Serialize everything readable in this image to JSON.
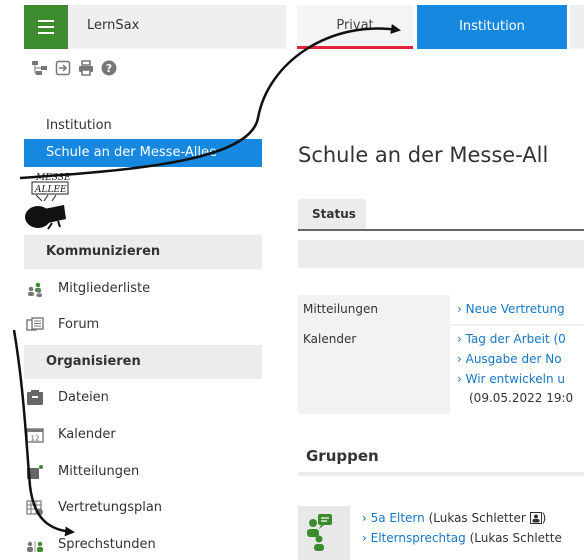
{
  "header": {
    "app_title": "LernSax",
    "tabs": [
      {
        "label": "Privat",
        "active": false
      },
      {
        "label": "Institution",
        "active": true
      }
    ]
  },
  "toolbar": {
    "icons": [
      "sitemap-icon",
      "sign-in-icon",
      "print-icon",
      "help-icon"
    ]
  },
  "sidebar": {
    "heading": "Institution",
    "active_item": "Schule an der Messe-Allee",
    "logo_text": "MESSE ALLEE",
    "sections": [
      {
        "title": "Kommunizieren",
        "items": [
          {
            "label": "Mitgliederliste",
            "icon": "members-icon"
          },
          {
            "label": "Forum",
            "icon": "forum-icon"
          }
        ]
      },
      {
        "title": "Organisieren",
        "items": [
          {
            "label": "Dateien",
            "icon": "files-icon"
          },
          {
            "label": "Kalender",
            "icon": "calendar-icon"
          },
          {
            "label": "Mitteilungen",
            "icon": "messages-icon"
          },
          {
            "label": "Vertretungsplan",
            "icon": "substitution-plan-icon"
          },
          {
            "label": "Sprechstunden",
            "icon": "office-hours-icon"
          }
        ]
      }
    ]
  },
  "main": {
    "page_title": "Schule an der Messe-All",
    "status_tab": "Status",
    "info": {
      "messages_label": "Mitteilungen",
      "messages_links": [
        "› Neue Vertretung"
      ],
      "calendar_label": "Kalender",
      "calendar_links": [
        "› Tag der Arbeit (0",
        "› Ausgabe der No",
        "› Wir entwickeln u"
      ],
      "calendar_extra": "(09.05.2022 19:0"
    },
    "groups_title": "Gruppen",
    "groups": [
      {
        "link": "› 5a Eltern",
        "owner": "(Lukas Schletter",
        "suffix": ")"
      },
      {
        "link": "› Elternsprechtag",
        "owner": "(Lukas Schlette",
        "suffix": ""
      }
    ]
  },
  "colors": {
    "brand_green": "#3d8b2f",
    "active_blue": "#1688df",
    "privat_underline": "#e0253a",
    "link": "#1677c9"
  }
}
